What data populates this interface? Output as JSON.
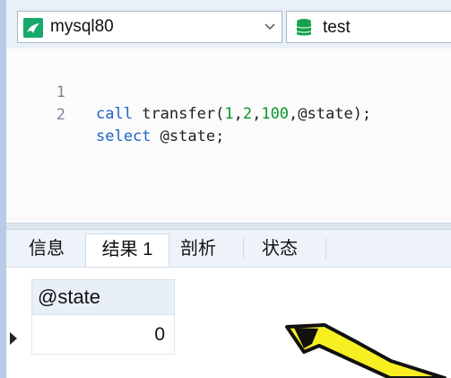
{
  "connection": {
    "label": "mysql80",
    "icon": "mysql-dolphin-icon",
    "icon_color": "#18a86b"
  },
  "database": {
    "label": "test",
    "icon": "database-icon",
    "icon_color": "#15a34a"
  },
  "editor": {
    "lines": [
      {
        "number": "1",
        "call_kw": "call",
        "fn_open": "transfer(",
        "arg1": "1",
        "c1": ",",
        "arg2": "2",
        "c2": ",",
        "arg3": "100",
        "tail": ",@state);"
      },
      {
        "number": "2",
        "select_kw": "select",
        "rest": "@state;"
      }
    ],
    "keyword_color": "#1d63c8",
    "number_color": "#08962a"
  },
  "tabs": [
    {
      "label": "信息",
      "active": false
    },
    {
      "label": "结果 1",
      "active": true
    },
    {
      "label": "剖析",
      "active": false
    },
    {
      "label": "状态",
      "active": false
    }
  ],
  "result": {
    "column": "@state",
    "value": "0"
  },
  "annotation": {
    "arrow_fill": "#f7ef22",
    "arrow_stroke": "#111111"
  }
}
